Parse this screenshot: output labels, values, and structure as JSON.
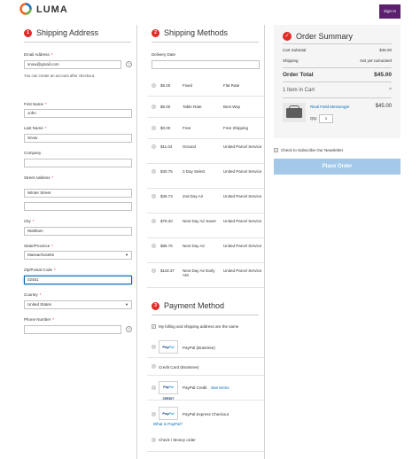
{
  "header": {
    "logo_text": "LUMA",
    "signin_label": "Sign In"
  },
  "shipping_address": {
    "step": "1",
    "title": "Shipping Address",
    "email_label": "Email Address",
    "email_value": "snow@gmail.com",
    "email_note": "You can create an account after checkout.",
    "first_name_label": "First Name",
    "first_name_value": "John",
    "last_name_label": "Last Name",
    "last_name_value": "Snow",
    "company_label": "Company",
    "company_value": "",
    "street_label": "Street Address",
    "street_value": "Winter Street",
    "street2_value": "",
    "city_label": "City",
    "city_value": "Waltham",
    "state_label": "State/Province",
    "state_value": "Massachusetts",
    "zip_label": "Zip/Postal Code",
    "zip_value": "02451",
    "country_label": "Country",
    "country_value": "United States",
    "phone_label": "Phone Number",
    "phone_value": "",
    "required_mark": "*",
    "help_mark": "?"
  },
  "shipping_methods": {
    "step": "2",
    "title": "Shipping Methods",
    "delivery_date_label": "Delivery Date",
    "delivery_date_value": "",
    "rows": [
      {
        "price": "$5.00",
        "method": "Fixed",
        "carrier": "Flat Rate"
      },
      {
        "price": "$5.00",
        "method": "Table Rate",
        "carrier": "Best Way"
      },
      {
        "price": "$0.00",
        "method": "Free",
        "carrier": "Free Shipping"
      },
      {
        "price": "$11.04",
        "method": "Ground",
        "carrier": "United Parcel Service"
      },
      {
        "price": "$30.75",
        "method": "3 Day Select",
        "carrier": "United Parcel Service"
      },
      {
        "price": "$36.73",
        "method": "2nd Day Air",
        "carrier": "United Parcel Service"
      },
      {
        "price": "$78.20",
        "method": "Next Day Air Saver",
        "carrier": "United Parcel Service"
      },
      {
        "price": "$85.76",
        "method": "Next Day Air",
        "carrier": "United Parcel Service"
      },
      {
        "price": "$118.37",
        "method": "Next Day Air Early AM",
        "carrier": "United Parcel Service"
      }
    ]
  },
  "payment": {
    "step": "3",
    "title": "Payment Method",
    "same_address_label": "My billing and shipping address are the same",
    "check_mark": "✓",
    "paypal_logo_a": "Pay",
    "paypal_logo_b": "Pal",
    "paypal_credit_logo": "CREDIT",
    "methods": {
      "braintree": "PayPal (Braintree)",
      "credit_card": "Credit Card (Braintree)",
      "paypal_credit": "PayPal Credit",
      "see_terms": "See terms",
      "express": "PayPal Express Checkout",
      "what_is_paypal": "What is PayPal?",
      "check_money": "Check / Money order"
    }
  },
  "order_summary": {
    "title": "Order Summary",
    "check_mark": "✓",
    "cart_subtotal_label": "Cart Subtotal",
    "cart_subtotal_value": "$45.00",
    "shipping_label": "Shipping",
    "shipping_value": "Not yet calculated",
    "order_total_label": "Order Total",
    "order_total_value": "$45.00",
    "items_in_cart": "1 Item in Cart",
    "collapse_icon": "^",
    "item_name": "Rival Field Messenger",
    "item_price": "$45.00",
    "qty_label": "Qty:",
    "qty_value": "1"
  },
  "newsletter": {
    "label": "Check to Subscribe Our Newsletter",
    "check_mark": "✓"
  },
  "place_order_label": "Place Order",
  "colors": {
    "accent_red": "#e02b27",
    "link_blue": "#006bb4",
    "signin_purple": "#5b1f6e",
    "place_order_blue": "#a3c8e8"
  }
}
